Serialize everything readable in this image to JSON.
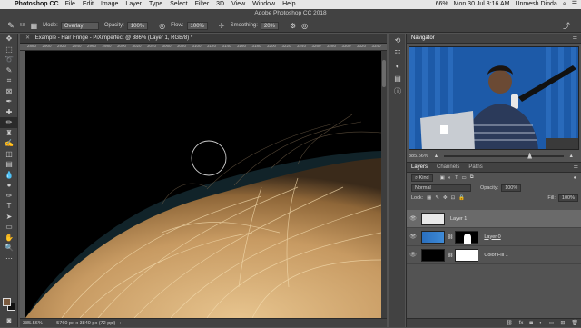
{
  "menubar": {
    "app": "Photoshop CC",
    "menus": [
      "File",
      "Edit",
      "Image",
      "Layer",
      "Type",
      "Select",
      "Filter",
      "3D",
      "View",
      "Window",
      "Help"
    ],
    "battery": "66%",
    "datetime": "Mon 30 Jul  8:16 AM",
    "user": "Unmesh Dinda"
  },
  "window_title": "Adobe Photoshop CC 2018",
  "options": {
    "brush_size": "58",
    "mode_label": "Mode:",
    "mode_value": "Overlay",
    "opacity_label": "Opacity:",
    "opacity_value": "100%",
    "flow_label": "Flow:",
    "flow_value": "100%",
    "smoothing_label": "Smoothing:",
    "smoothing_value": "20%"
  },
  "document_tab": "Example - Hair Fringe - PiXimperfect @ 386% (Layer 1, RGB/8) *",
  "ruler_ticks": [
    "2880",
    "2900",
    "2920",
    "2940",
    "2960",
    "2980",
    "3000",
    "3020",
    "3040",
    "3060",
    "3080",
    "3100",
    "3120",
    "3140",
    "3160",
    "3180",
    "3200",
    "3220",
    "3240",
    "3260",
    "3280",
    "3300",
    "3320",
    "3340"
  ],
  "status": {
    "zoom": "385.56%",
    "doc_info": "5760 px x 3840 px (72 ppi)"
  },
  "navigator": {
    "title": "Navigator",
    "zoom": "385.56%"
  },
  "layers_panel": {
    "tabs": [
      "Layers",
      "Channels",
      "Paths"
    ],
    "kind": "Kind",
    "blend": "Normal",
    "opacity_label": "Opacity:",
    "opacity_value": "100%",
    "lock_label": "Lock:",
    "fill_label": "Fill:",
    "fill_value": "100%",
    "layers": [
      {
        "name": "Layer 1",
        "selected": true
      },
      {
        "name": "Layer 0",
        "selected": false
      },
      {
        "name": "Color Fill 1",
        "selected": false
      }
    ]
  }
}
